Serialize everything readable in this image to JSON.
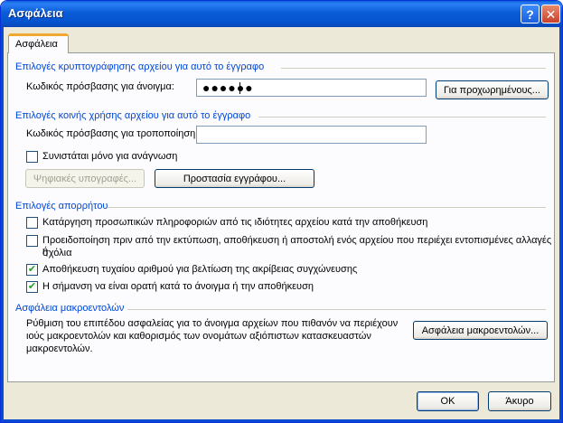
{
  "window": {
    "title": "Ασφάλεια",
    "help_glyph": "?",
    "close_glyph": "✕"
  },
  "tab": {
    "label": "Ασφάλεια"
  },
  "encryption": {
    "title": "Επιλογές κρυπτογράφησης αρχείου για αυτό το έγγραφο",
    "password_label": "Κωδικός πρόσβασης για άνοιγμα:",
    "password_value": "●●●●●●",
    "advanced_button": "Για προχωρημένους..."
  },
  "sharing": {
    "title": "Επιλογές κοινής χρήσης αρχείου για αυτό το έγγραφο",
    "modify_label": "Κωδικός πρόσβασης για τροποποίηση:",
    "modify_value": "",
    "readonly_label": "Συνιστάται μόνο για ανάγνωση",
    "readonly_checked": false,
    "digital_signatures_button": "Ψηφιακές υπογραφές...",
    "protect_document_button": "Προστασία εγγράφου..."
  },
  "privacy": {
    "title": "Επιλογές απορρήτου",
    "options": [
      {
        "label": "Κατάργηση προσωπικών πληροφοριών από τις ιδιότητες αρχείου κατά την αποθήκευση",
        "checked": false
      },
      {
        "label_line1": "Προειδοποίηση πριν από την εκτύπωση, αποθήκευση ή αποστολή ενός αρχείου που περιέχει εντοπισμένες αλλαγές ή",
        "label_line2": "σχόλια",
        "checked": false
      },
      {
        "label": "Αποθήκευση τυχαίου αριθμού για βελτίωση της ακρίβειας συγχώνευσης",
        "checked": true
      },
      {
        "label": "Η σήμανση να είναι ορατή κατά το άνοιγμα ή την αποθήκευση",
        "checked": true
      }
    ]
  },
  "macro": {
    "title": "Ασφάλεια μακροεντολών",
    "desc_line1": "Ρύθμιση του επιπέδου ασφαλείας για το άνοιγμα αρχείων που πιθανόν να περιέχουν",
    "desc_line2": "ιούς μακροεντολών και καθορισμός των ονομάτων αξιόπιστων κατασκευαστών",
    "desc_line3": "μακροεντολών.",
    "button": "Ασφάλεια μακροεντολών..."
  },
  "footer": {
    "ok": "OK",
    "cancel": "Άκυρο"
  },
  "colors": {
    "group_title": "#0046d5",
    "check": "#21a121",
    "titlebar": "#0553d0"
  }
}
